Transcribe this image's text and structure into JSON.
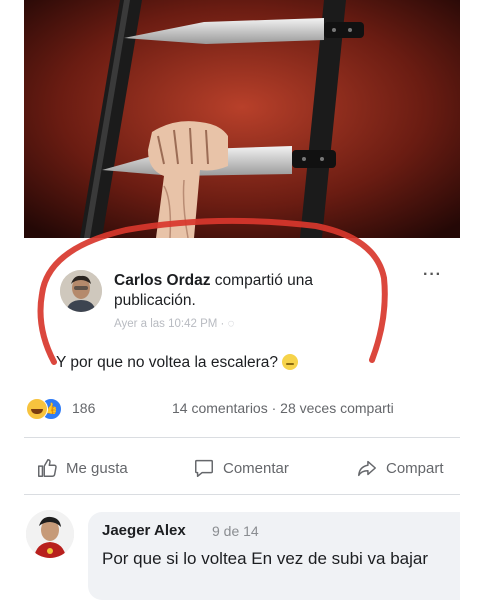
{
  "shared_post": {
    "author": "Carlos Ordaz",
    "action_text": " compartió una publicación.",
    "timestamp": "Ayer a las 10:42 PM · ",
    "more_icon": "more-dots-icon",
    "text": "Y por que no voltea la escalera?",
    "emoji": "neutral-face-emoji"
  },
  "stats": {
    "reaction_icons": [
      "haha-reaction-icon",
      "like-reaction-icon"
    ],
    "reactions_count": "186",
    "comments_shares": "14 comentarios · 28 veces comparti"
  },
  "actions": {
    "like": "Me gusta",
    "comment": "Comentar",
    "share": "Compart"
  },
  "comment": {
    "author": "Jaeger Alex",
    "date": "9 de 14",
    "text": "Por que si lo voltea En vez de subi va bajar"
  },
  "colors": {
    "scribble": "#d8372c",
    "like_blue": "#2f7cf6",
    "haha_yellow": "#f7c33e",
    "muted_text": "#65676b",
    "bubble": "#f0f2f5",
    "illustration_bg": "#5a1a12"
  }
}
